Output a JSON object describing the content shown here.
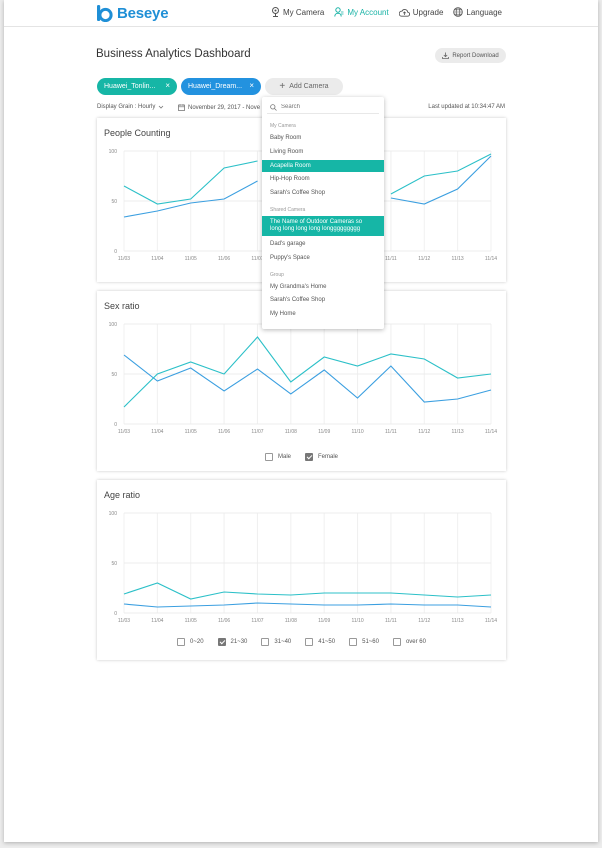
{
  "brand": {
    "name": "Beseye",
    "color": "#1f8fd6"
  },
  "nav": {
    "my_camera": "My Camera",
    "my_account": "My Account",
    "upgrade": "Upgrade",
    "language": "Language"
  },
  "page_title": "Business Analytics Dashboard",
  "report_download": "Report Download",
  "chips": [
    "Huawei_Tonlin...",
    "Huawei_Dream..."
  ],
  "add_camera": "Add Camera",
  "display_grain": "Display Grain : Hourly",
  "date_range": "November 29, 2017 - Nove",
  "last_updated": "Last updated at 10:34:47 AM",
  "dropdown": {
    "search_placeholder": "Search",
    "groups": [
      {
        "label": "My Camera",
        "items": [
          "Baby Room",
          "Living Room",
          "Acapella Room",
          "Hip-Hop Room",
          "Sarah's Coffee Shop"
        ],
        "selected": 2
      },
      {
        "label": "Shared Camera",
        "items": [
          "The Name of Outdoor Cameras so long long long long longgggggggg",
          "Dad's garage",
          "Puppy's Space"
        ],
        "selected": 0
      },
      {
        "label": "Group",
        "items": [
          "My Grandma's Home",
          "Sarah's Coffee Shop",
          "My Home"
        ],
        "selected": -1
      }
    ]
  },
  "colors": {
    "teal": "#2cc0c8",
    "blue": "#3b9fe0",
    "accent": "#16b6a6",
    "chip_blue": "#2392df"
  },
  "chart_data": [
    {
      "type": "line",
      "title": "People Counting",
      "x": [
        "11/03",
        "11/04",
        "11/05",
        "11/06",
        "11/07",
        "11/08",
        "11/09",
        "11/10",
        "11/11",
        "11/12",
        "11/13",
        "11/14"
      ],
      "ylim": [
        0,
        100
      ],
      "yticks": [
        0,
        50,
        100
      ],
      "series": [
        {
          "color": "#2cc0c8",
          "values": [
            65,
            47,
            52,
            83,
            90,
            null,
            null,
            null,
            57,
            75,
            80,
            97
          ]
        },
        {
          "color": "#3b9fe0",
          "values": [
            34,
            40,
            48,
            52,
            70,
            null,
            null,
            null,
            53,
            47,
            62,
            95
          ]
        }
      ]
    },
    {
      "type": "line",
      "title": "Sex ratio",
      "x": [
        "11/03",
        "11/04",
        "11/05",
        "11/06",
        "11/07",
        "11/08",
        "11/09",
        "11/10",
        "11/11",
        "11/12",
        "11/13",
        "11/14"
      ],
      "ylim": [
        0,
        100
      ],
      "yticks": [
        0,
        50,
        100
      ],
      "series": [
        {
          "name": "Male",
          "color": "#3b9fe0",
          "values": [
            69,
            43,
            56,
            33,
            55,
            30,
            54,
            26,
            58,
            22,
            25,
            34
          ]
        },
        {
          "name": "Female",
          "color": "#2cc0c8",
          "values": [
            17,
            50,
            62,
            50,
            87,
            42,
            67,
            58,
            70,
            65,
            46,
            50
          ]
        }
      ],
      "legend": [
        {
          "label": "Male",
          "checked": false
        },
        {
          "label": "Female",
          "checked": true
        }
      ]
    },
    {
      "type": "line",
      "title": "Age ratio",
      "x": [
        "11/03",
        "11/04",
        "11/05",
        "11/06",
        "11/07",
        "11/08",
        "11/09",
        "11/10",
        "11/11",
        "11/12",
        "11/13",
        "11/14"
      ],
      "ylim": [
        0,
        100
      ],
      "yticks": [
        0,
        50,
        100
      ],
      "series": [
        {
          "name": "21~30",
          "color": "#2cc0c8",
          "values": [
            19,
            30,
            14,
            21,
            19,
            18,
            20,
            20,
            20,
            18,
            16,
            18
          ]
        },
        {
          "name": "0~20",
          "color": "#3b9fe0",
          "values": [
            9,
            6,
            7,
            8,
            10,
            9,
            8,
            8,
            9,
            8,
            8,
            6
          ]
        }
      ],
      "legend": [
        {
          "label": "0~20",
          "checked": false
        },
        {
          "label": "21~30",
          "checked": true
        },
        {
          "label": "31~40",
          "checked": false
        },
        {
          "label": "41~50",
          "checked": false
        },
        {
          "label": "51~60",
          "checked": false
        },
        {
          "label": "over 60",
          "checked": false
        }
      ]
    }
  ]
}
